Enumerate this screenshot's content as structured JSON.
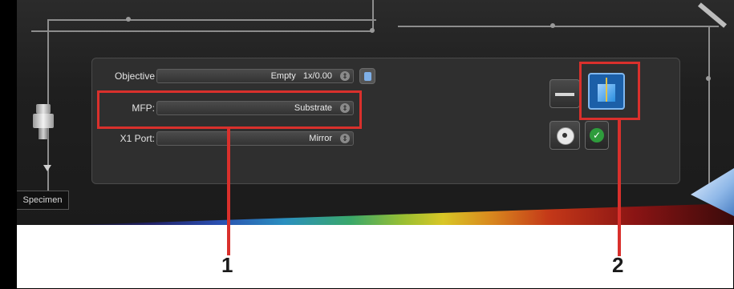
{
  "objective": {
    "label": "Objective",
    "value": "Empty   1x/0.00"
  },
  "mfp": {
    "label": "MFP:",
    "value": "Substrate"
  },
  "x1_port": {
    "label": "X1 Port:",
    "value": "Mirror"
  },
  "specimen_label": "Specimen",
  "callouts": {
    "one": "1",
    "two": "2"
  },
  "colors": {
    "highlight": "#d9302c",
    "panel": "#2f2f2f",
    "background": "#1f1f1f",
    "accent": "#2a8fe0",
    "confirm": "#2e9c3c"
  },
  "icons": {
    "objective_extra": "small-sample-icon",
    "beam_off": "dash-icon",
    "sample_view": "sample-cube-icon",
    "settings": "reel-icon",
    "confirm": "check-icon",
    "corner": "triangle-prism-icon"
  }
}
